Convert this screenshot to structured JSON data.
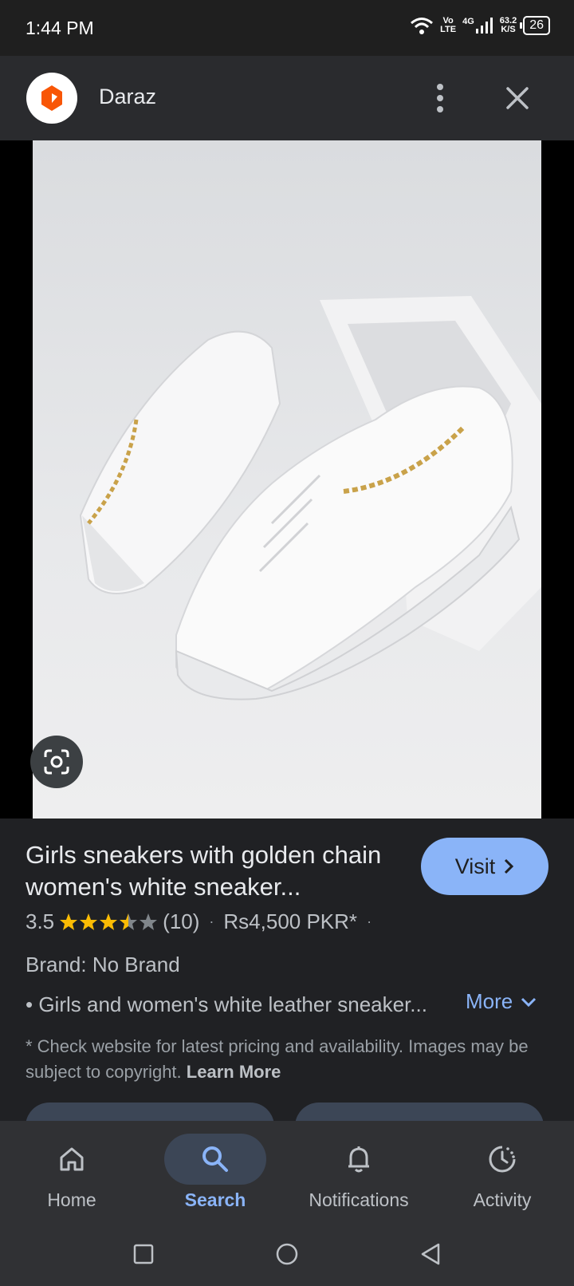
{
  "status_bar": {
    "time": "1:44 PM",
    "network_top": "Vo",
    "network_bottom": "LTE",
    "network_type": "4G",
    "speed_value": "63.2",
    "speed_unit": "K/S",
    "battery": "26"
  },
  "header": {
    "site_name": "Daraz",
    "logo_icon": "daraz-logo",
    "menu_icon": "more-vert-icon",
    "close_icon": "close-icon"
  },
  "product": {
    "title": "Girls sneakers with golden chain women's white sneaker...",
    "visit_label": "Visit",
    "rating": "3.5",
    "rating_value": 3.5,
    "review_count": "(10)",
    "price": "Rs4,500 PKR*",
    "brand": "Brand: No Brand",
    "description": "• Girls and women's white leather sneaker...",
    "more_label": "More",
    "disclaimer": "* Check website for latest pricing and availability. Images may be subject to copyright.",
    "learn_more": "Learn More"
  },
  "bottom_nav": [
    {
      "label": "Home",
      "icon": "home-icon",
      "active": false
    },
    {
      "label": "Search",
      "icon": "search-icon",
      "active": true
    },
    {
      "label": "Notifications",
      "icon": "bell-icon",
      "active": false
    },
    {
      "label": "Activity",
      "icon": "activity-icon",
      "active": false
    }
  ],
  "colors": {
    "accent": "#8ab4f8",
    "background": "#202124",
    "star": "#fbbc04",
    "daraz_orange": "#f85606"
  }
}
